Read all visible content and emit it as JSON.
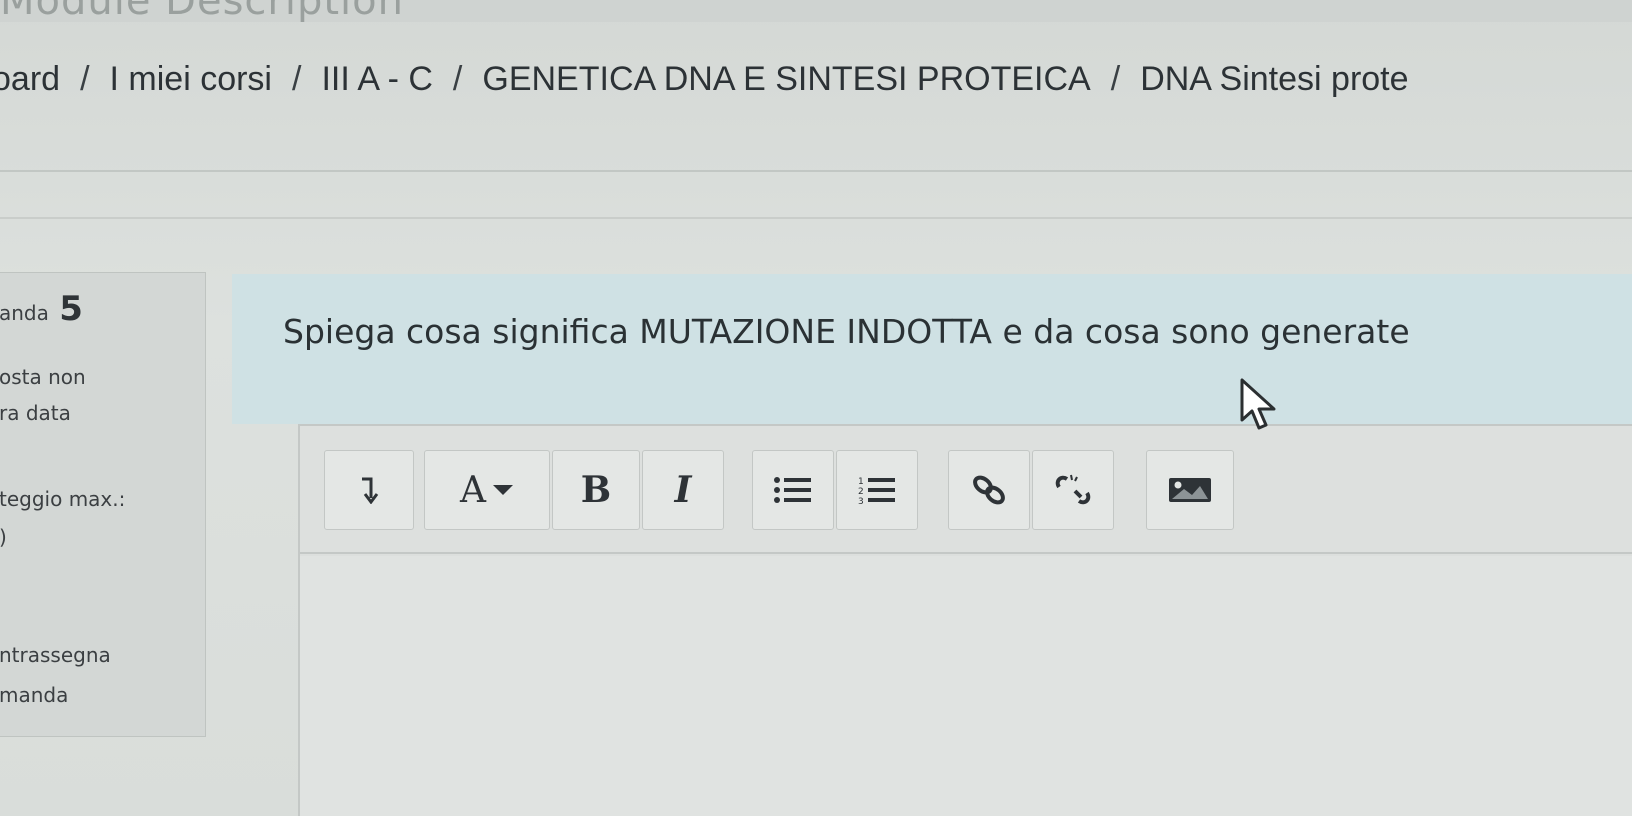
{
  "top": {
    "title_fragment": "Module Description"
  },
  "breadcrumb": {
    "items": [
      "oard",
      "I miei corsi",
      "III A - C",
      "GENETICA DNA E SINTESI PROTEICA",
      "DNA Sintesi prote"
    ],
    "separator": "/"
  },
  "question_info": {
    "label": "anda",
    "number": "5",
    "status_line1": "osta non",
    "status_line2": "ra data",
    "max_score_label": "teggio max.:",
    "max_score_value": ")",
    "flag_line1": "ntrassegna",
    "flag_line2": "manda"
  },
  "question": {
    "text": "Spiega cosa significa MUTAZIONE INDOTTA  e  da cosa sono generate"
  },
  "toolbar": {
    "buttons": [
      {
        "name": "expand-toolbar-icon"
      },
      {
        "name": "font-color-icon",
        "label": "A"
      },
      {
        "name": "bold-icon",
        "label": "B"
      },
      {
        "name": "italic-icon",
        "label": "I"
      },
      {
        "name": "unordered-list-icon"
      },
      {
        "name": "ordered-list-icon"
      },
      {
        "name": "link-icon"
      },
      {
        "name": "unlink-icon"
      },
      {
        "name": "image-icon"
      }
    ]
  },
  "editor": {
    "value": ""
  },
  "colors": {
    "page_bg": "#d8dcd9",
    "question_bg": "#cfe1e4",
    "info_bg": "#d3d7d5",
    "text": "#2f3336"
  }
}
